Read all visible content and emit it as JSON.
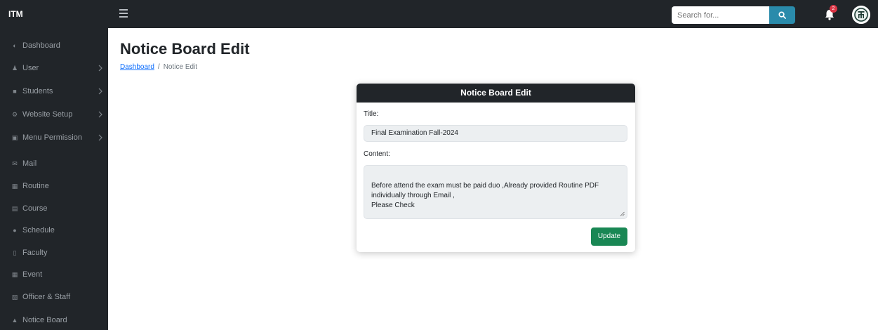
{
  "brand": "ITM",
  "search": {
    "placeholder": "Search for..."
  },
  "notifications": {
    "count": "2"
  },
  "sidebar": {
    "items": [
      {
        "label": "Dashboard",
        "icon": "dashboard-icon",
        "has_submenu": false
      },
      {
        "label": "User",
        "icon": "users-icon",
        "has_submenu": true
      },
      {
        "label": "Students",
        "icon": "student-icon",
        "has_submenu": true
      },
      {
        "label": "Website Setup",
        "icon": "gears-icon",
        "has_submenu": true
      },
      {
        "label": "Menu Permission",
        "icon": "lock-icon",
        "has_submenu": true
      },
      {
        "label": "Mail",
        "icon": "envelope-icon",
        "has_submenu": false
      },
      {
        "label": "Routine",
        "icon": "calendar-icon",
        "has_submenu": false
      },
      {
        "label": "Course",
        "icon": "book-icon",
        "has_submenu": false
      },
      {
        "label": "Schedule",
        "icon": "clock-icon",
        "has_submenu": false
      },
      {
        "label": "Faculty",
        "icon": "chalkboard-icon",
        "has_submenu": false
      },
      {
        "label": "Event",
        "icon": "event-calendar-icon",
        "has_submenu": false
      },
      {
        "label": "Officer & Staff",
        "icon": "id-card-icon",
        "has_submenu": false
      },
      {
        "label": "Notice Board",
        "icon": "bell-icon",
        "has_submenu": false
      }
    ]
  },
  "page": {
    "title": "Notice Board Edit",
    "breadcrumb": {
      "link": "Dashboard",
      "separator": "/",
      "current": "Notice Edit"
    }
  },
  "form": {
    "header": "Notice Board Edit",
    "title_label": "Title:",
    "title_value": "Final Examination Fall-2024",
    "content_label": "Content:",
    "content_value": "Before attend the exam must be paid duo ,Already provided Routine PDF individually through Email ,\nPlease Check",
    "submit_label": "Update"
  },
  "colors": {
    "topbar": "#212529",
    "sidebar": "#212529",
    "search_button": "#2a8bab",
    "update_button": "#198754",
    "badge": "#dc3545",
    "link": "#0d6efd"
  }
}
